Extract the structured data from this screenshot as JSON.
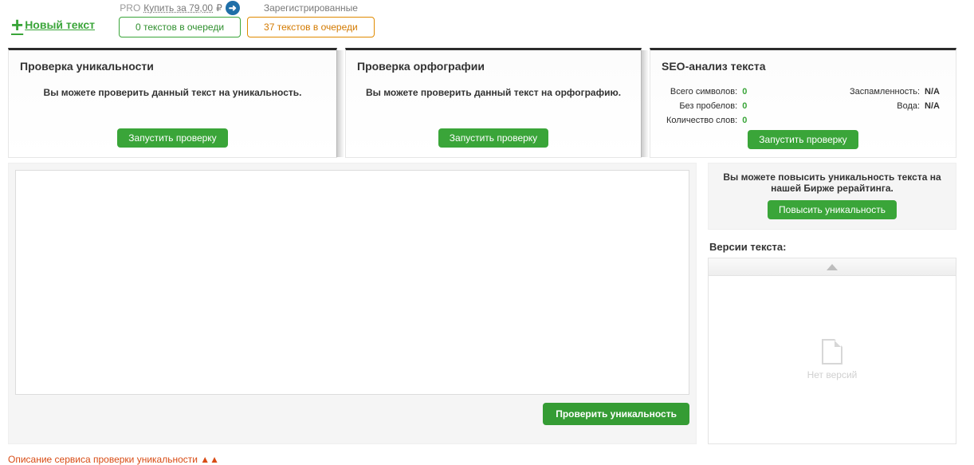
{
  "header": {
    "new_text": "Новый текст",
    "pro_label": "PRO",
    "pro_buy": "Купить за 79,00",
    "pro_currency": "₽",
    "queue_own": "0 текстов в очереди",
    "registered_label": "Зарегистрированные",
    "queue_reg": "37 текстов в очереди"
  },
  "panels": {
    "uniq": {
      "title": "Проверка уникальности",
      "desc": "Вы можете проверить данный текст на уникальность.",
      "run": "Запустить проверку"
    },
    "spell": {
      "title": "Проверка орфографии",
      "desc": "Вы можете проверить данный текст на орфографию.",
      "run": "Запустить проверку"
    },
    "seo": {
      "title": "SEO-анализ текста",
      "total_chars_label": "Всего символов:",
      "total_chars": "0",
      "no_spaces_label": "Без пробелов:",
      "no_spaces": "0",
      "words_label": "Количество слов:",
      "words": "0",
      "spam_label": "Заспамленность:",
      "spam": "N/A",
      "water_label": "Вода:",
      "water": "N/A",
      "run": "Запустить проверку"
    }
  },
  "editor": {
    "value": "",
    "check_btn": "Проверить уникальность"
  },
  "sidebar": {
    "promo_text": "Вы можете повысить уникальность текста на нашей Бирже рерайтинга.",
    "promo_btn": "Повысить уникальность",
    "versions_title": "Версии текста:",
    "no_versions": "Нет версий"
  },
  "footer": {
    "desc_link": "Описание сервиса проверки уникальности ▲▲"
  }
}
